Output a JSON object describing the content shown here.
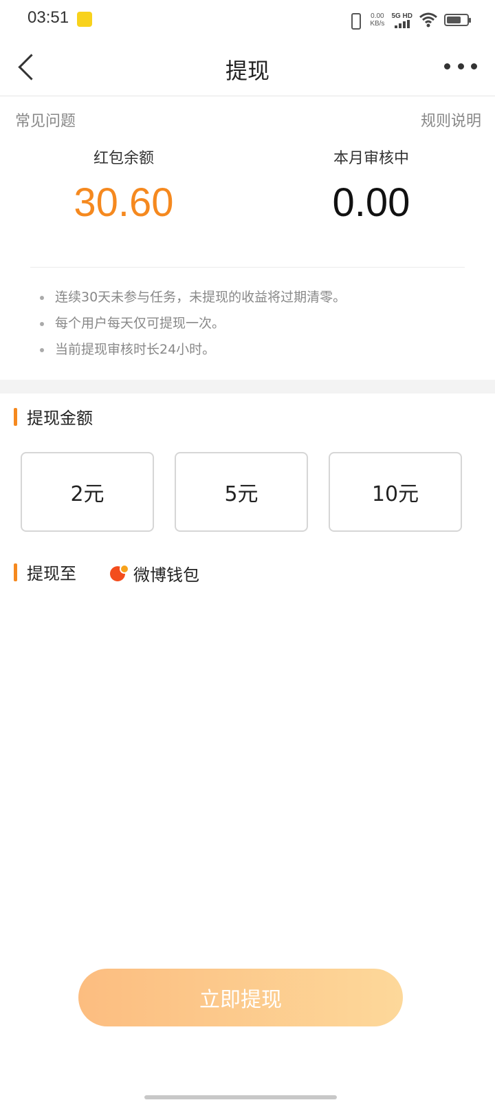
{
  "status_bar": {
    "time": "03:51",
    "net_speed_value": "0.00",
    "net_speed_unit": "KB/s",
    "network_type": "5G HD",
    "icons": [
      "vibrate-icon",
      "signal-icon",
      "wifi-icon",
      "battery-icon"
    ]
  },
  "header": {
    "title": "提现",
    "back_icon": "chevron-left-icon",
    "more_icon": "more-dots-icon"
  },
  "links": {
    "faq": "常见问题",
    "rules": "规则说明"
  },
  "balances": {
    "red_packet_label": "红包余额",
    "red_packet_value": "30.60",
    "pending_label": "本月审核中",
    "pending_value": "0.00"
  },
  "notes": [
    "连续30天未参与任务，未提现的收益将过期清零。",
    "每个用户每天仅可提现一次。",
    "当前提现审核时长24小时。"
  ],
  "withdraw_amount": {
    "section_title": "提现金额",
    "options": [
      "2元",
      "5元",
      "10元"
    ]
  },
  "withdraw_to": {
    "section_title": "提现至",
    "destination": "微博钱包"
  },
  "action": {
    "button_label": "立即提现"
  },
  "colors": {
    "accent": "#f5891f",
    "button_gradient_start": "#fcbd80",
    "button_gradient_end": "#fdd89a"
  }
}
